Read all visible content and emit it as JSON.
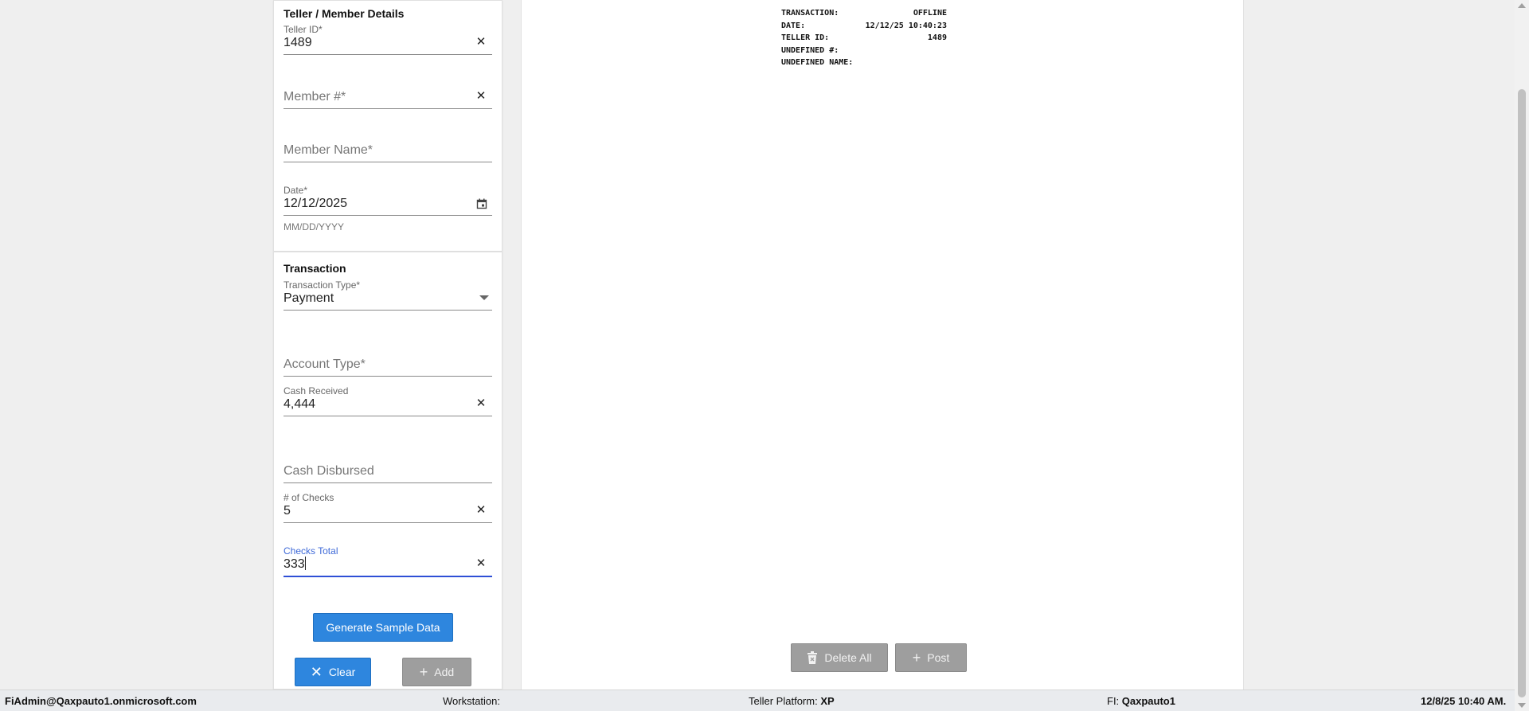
{
  "details": {
    "title": "Teller / Member Details",
    "teller_id": {
      "label": "Teller ID*",
      "value": "1489"
    },
    "member_number": {
      "placeholder": "Member #*"
    },
    "member_name": {
      "placeholder": "Member Name*"
    },
    "date": {
      "label": "Date*",
      "value": "12/12/2025",
      "helper": "MM/DD/YYYY"
    }
  },
  "transaction": {
    "title": "Transaction",
    "type": {
      "label": "Transaction Type*",
      "value": "Payment"
    },
    "account_type": {
      "placeholder": "Account Type*"
    },
    "cash_received": {
      "label": "Cash Received",
      "value": "4,444"
    },
    "cash_disbursed": {
      "placeholder": "Cash Disbursed"
    },
    "num_checks": {
      "label": "# of Checks",
      "value": "5"
    },
    "checks_total": {
      "label": "Checks Total",
      "value": "333"
    }
  },
  "buttons": {
    "generate_sample": "Generate Sample Data",
    "clear": "Clear",
    "add": "Add",
    "delete_all": "Delete All",
    "post": "Post"
  },
  "receipt": {
    "rows": [
      {
        "label": "TRANSACTION:",
        "value": "OFFLINE"
      },
      {
        "label": "DATE:",
        "value": "12/12/25 10:40:23"
      },
      {
        "label": "TELLER ID:",
        "value": "1489"
      },
      {
        "label": "UNDEFINED #:",
        "value": ""
      },
      {
        "label": "UNDEFINED NAME:",
        "value": ""
      }
    ]
  },
  "statusbar": {
    "user": "FiAdmin@Qaxpauto1.onmicrosoft.com",
    "workstation_label": "Workstation:",
    "platform_label": "Teller Platform:",
    "platform_value": "XP",
    "fi_label": "FI:",
    "fi_value": "Qaxpauto1",
    "datetime": "12/8/25 10:40 AM."
  },
  "colors": {
    "primary": "#2e86de",
    "disabled": "#9e9e9e",
    "focus": "#2f4fd6"
  }
}
